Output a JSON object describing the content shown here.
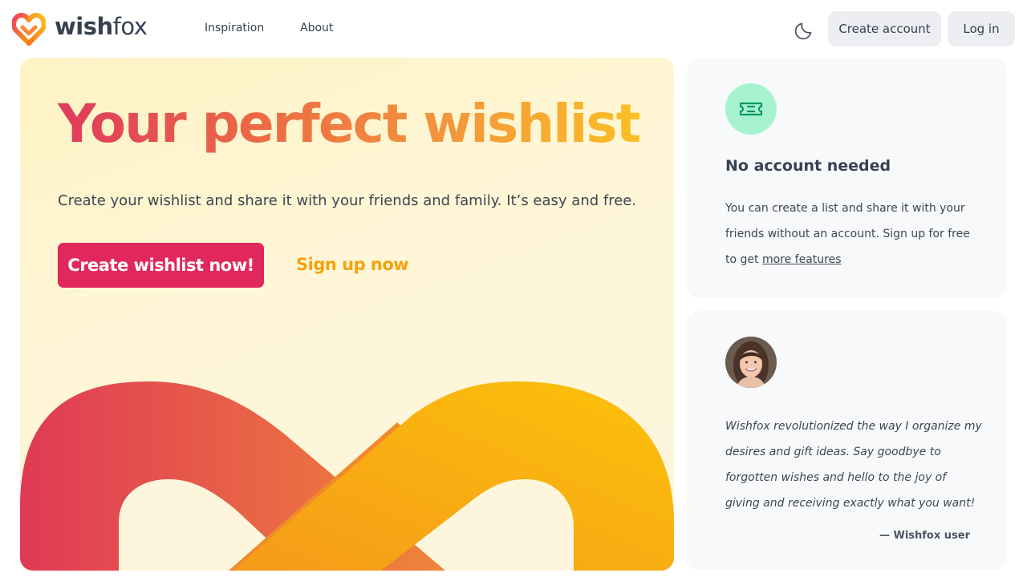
{
  "header": {
    "logo_bold": "wish",
    "logo_light": "fox",
    "nav": [
      {
        "label": "Inspiration"
      },
      {
        "label": "About"
      }
    ],
    "theme_toggle_icon": "moon-icon",
    "create_account_label": "Create account",
    "login_label": "Log in"
  },
  "hero": {
    "title": "Your perfect wishlist",
    "subtitle": "Create your wishlist and share it with your friends and family. It’s easy and free.",
    "cta_primary": "Create wishlist now!",
    "cta_secondary": "Sign up now",
    "colors": {
      "primary": "#e1285c",
      "secondary": "#f5a20e",
      "background": "#fef3c4"
    }
  },
  "features_card": {
    "icon": "ticket-icon",
    "heading": "No account needed",
    "text": "You can create a list and share it with your friends without an account. Sign up for free to get",
    "link": "more features"
  },
  "testimonial": {
    "avatar": "user-avatar",
    "quote": "Wishfox revolutionized the way I organize my desires and gift ideas. Say goodbye to forgotten wishes and hello to the joy of giving and receiving exactly what you want!",
    "author": "— Wishfox user"
  }
}
